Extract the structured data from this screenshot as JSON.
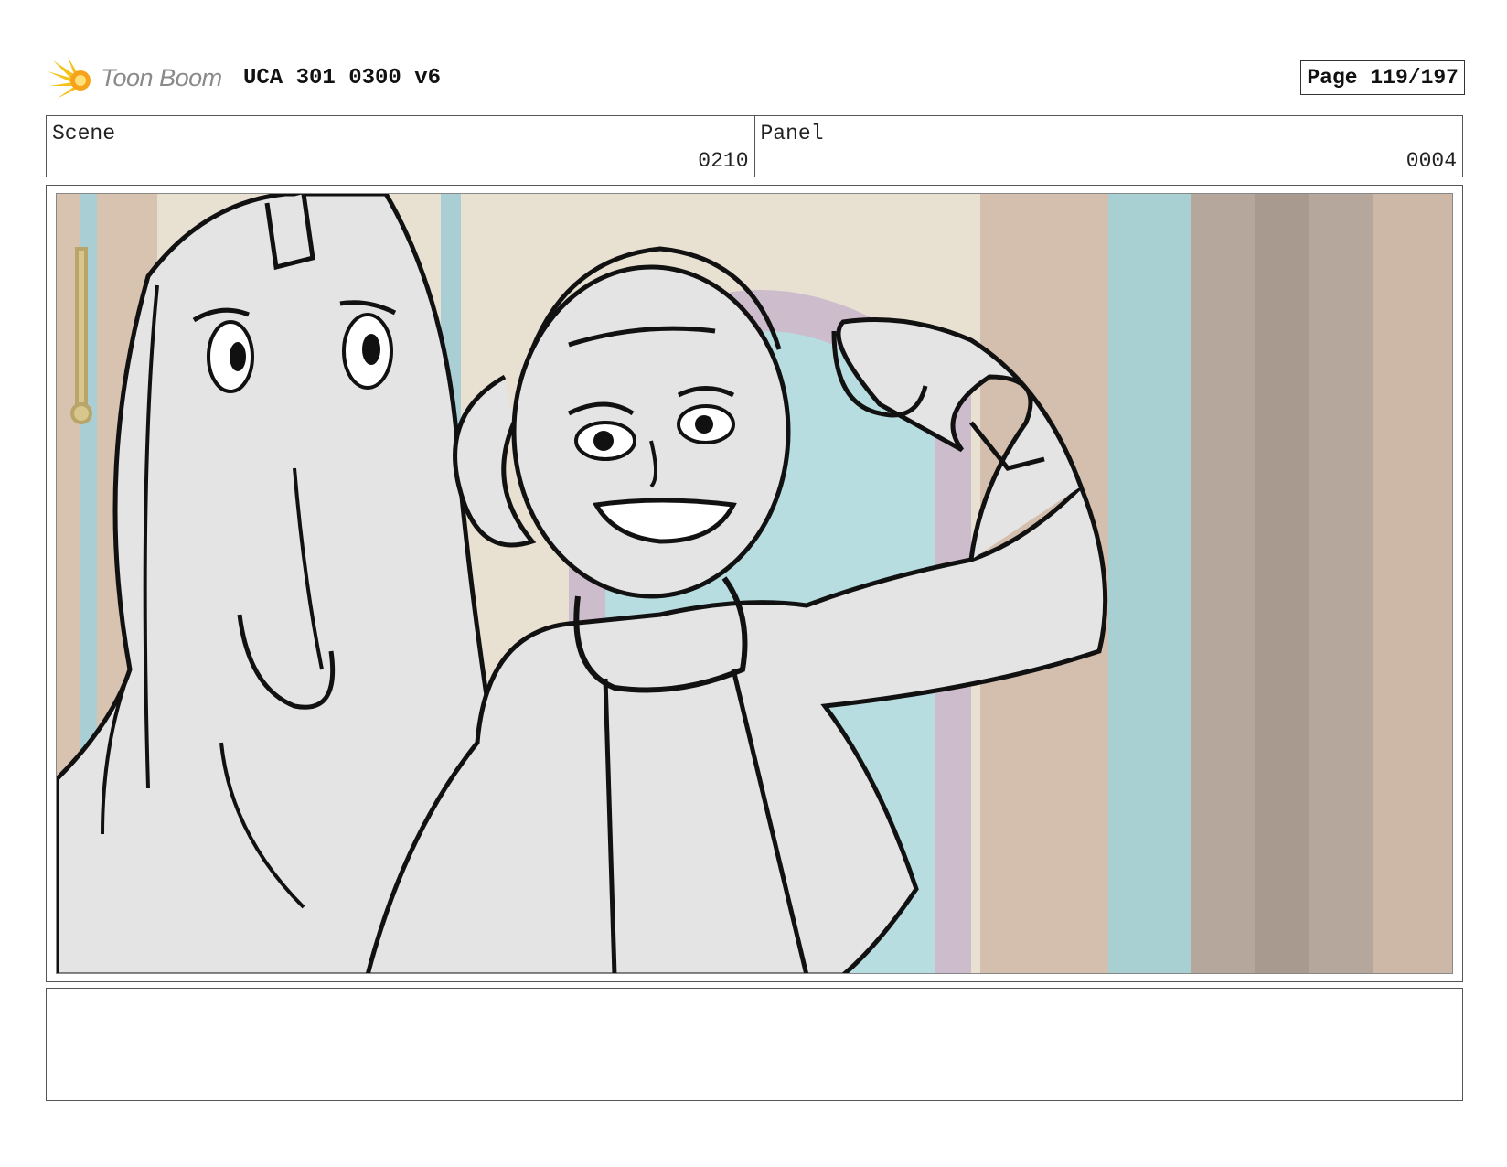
{
  "header": {
    "logo_text": "Toon Boom",
    "logo_icon": "starburst-logo-icon",
    "title": "UCA 301 0300 v6",
    "page_label": "Page 119/197"
  },
  "info": {
    "scene_label": "Scene",
    "scene_value": "0210",
    "panel_label": "Panel",
    "panel_value": "0004"
  },
  "panel": {
    "image_subject": "storyboard-sketch",
    "colors": {
      "wall": "#d9c3b1",
      "curtain": "#b7a79b",
      "window": "#b5dde0",
      "arch": "#c9b7c8",
      "figure_fill": "#e4e4e4",
      "ink": "#111111"
    }
  },
  "notes": {
    "text": ""
  }
}
